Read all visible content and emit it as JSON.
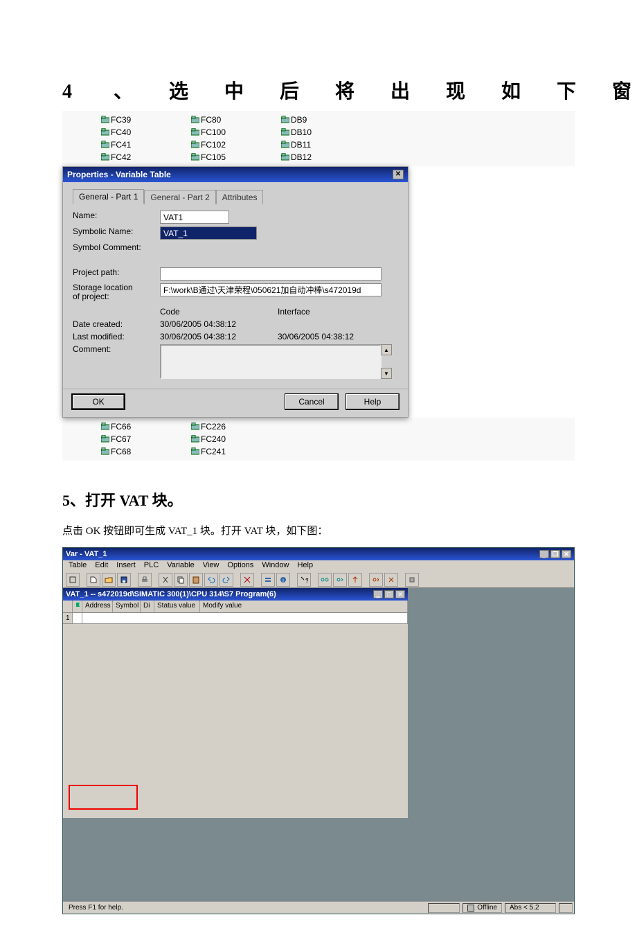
{
  "heading4_num": "4",
  "heading4": "、选中后将出现如下窗口",
  "bg_list": {
    "rows": [
      {
        "a": "FC39",
        "b": "FC80",
        "c": "DB9"
      },
      {
        "a": "FC40",
        "b": "FC100",
        "c": "DB10"
      },
      {
        "a": "FC41",
        "b": "FC102",
        "c": "DB11"
      },
      {
        "a": "FC42",
        "b": "FC105",
        "c": "DB12"
      }
    ]
  },
  "dialog": {
    "title": "Properties - Variable Table",
    "tabs": {
      "t1": "General - Part 1",
      "t2": "General - Part 2",
      "t3": "Attributes"
    },
    "labels": {
      "name": "Name:",
      "symname": "Symbolic Name:",
      "symcomment": "Symbol Comment:",
      "projpath": "Project path:",
      "storage": "Storage location\nof project:",
      "code": "Code",
      "interface": "Interface",
      "created": "Date created:",
      "modified": "Last modified:",
      "comment": "Comment:"
    },
    "values": {
      "name": "VAT1",
      "symname": "VAT_1",
      "symcomment": "",
      "projpath": "",
      "storage": "F:\\work\\B通过\\天津荣程\\050621加自动冲棒\\s472019d",
      "created_code": "30/06/2005  04:38:12",
      "modified_code": "30/06/2005  04:38:12",
      "modified_interface": "30/06/2005  04:38:12"
    },
    "btn_ok": "OK",
    "btn_cancel": "Cancel",
    "btn_help": "Help"
  },
  "bg_list2": {
    "rows": [
      {
        "a": "FC66",
        "b": "FC226"
      },
      {
        "a": "FC67",
        "b": "FC240"
      },
      {
        "a": "FC68",
        "b": "FC241"
      }
    ]
  },
  "heading5": "5、打开 VAT 块。",
  "body5": "点击 OK 按钮即可生成 VAT_1 块。打开 VAT 块，如下图：",
  "app": {
    "title": "Var - VAT_1",
    "menus": [
      "Table",
      "Edit",
      "Insert",
      "PLC",
      "Variable",
      "View",
      "Options",
      "Window",
      "Help"
    ],
    "doc_title": "VAT_1 -- s472019d\\SIMATIC 300(1)\\CPU 314\\S7 Program(6)",
    "cols": {
      "addr": "Address",
      "sym": "Symbol",
      "di": "Di",
      "st": "Status value",
      "mv": "Modify value"
    },
    "row1": "1"
  },
  "status": {
    "help": "Press F1 for help.",
    "offline": "Offline",
    "abs": "Abs < 5.2"
  }
}
